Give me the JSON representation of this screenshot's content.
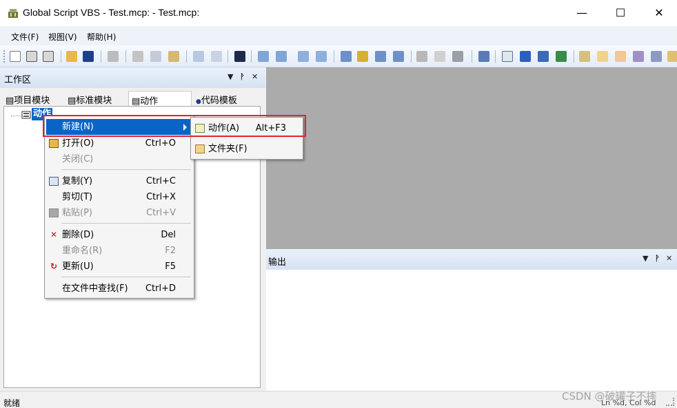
{
  "window": {
    "title": "Global Script VBS - Test.mcp: - Test.mcp:",
    "minimize": "—",
    "maximize": "☐",
    "close": "✕"
  },
  "menubar": {
    "items": [
      "文件(F)",
      "视图(V)",
      "帮助(H)"
    ]
  },
  "workspace": {
    "title": "工作区",
    "controls": {
      "dropdown": "▼",
      "pin": "ᚹ",
      "close": "✕"
    },
    "tabs": [
      {
        "icon": "script-module-icon",
        "label": "项目模块"
      },
      {
        "icon": "script-module-icon",
        "label": "标准模块"
      },
      {
        "icon": "script-module-icon",
        "label": "动作"
      },
      {
        "icon": "template-dot-icon",
        "label": "代码模板"
      }
    ],
    "tree": {
      "root_label": "动作"
    }
  },
  "context_menu": {
    "items": [
      {
        "icon": "",
        "label": "新建(N)",
        "shortcut": "",
        "has_submenu": true,
        "highlighted": true,
        "disabled": false
      },
      {
        "icon": "open-folder-icon",
        "label": "打开(O)",
        "shortcut": "Ctrl+O",
        "disabled": false
      },
      {
        "icon": "",
        "label": "关闭(C)",
        "shortcut": "",
        "disabled": true
      },
      {
        "icon": "copy-icon",
        "label": "复制(Y)",
        "shortcut": "Ctrl+C",
        "disabled": false
      },
      {
        "icon": "",
        "label": "剪切(T)",
        "shortcut": "Ctrl+X",
        "disabled": false
      },
      {
        "icon": "paste-icon",
        "label": "粘贴(P)",
        "shortcut": "Ctrl+V",
        "disabled": true
      },
      {
        "icon": "delete-icon",
        "label": "删除(D)",
        "shortcut": "Del",
        "disabled": false
      },
      {
        "icon": "",
        "label": "重命名(R)",
        "shortcut": "F2",
        "disabled": true
      },
      {
        "icon": "refresh-icon",
        "label": "更新(U)",
        "shortcut": "F5",
        "disabled": false
      },
      {
        "icon": "",
        "label": "在文件中查找(F)",
        "shortcut": "Ctrl+D",
        "disabled": false
      }
    ]
  },
  "submenu": {
    "items": [
      {
        "icon": "action-file-icon",
        "label": "动作(A)",
        "shortcut": "Alt+F3"
      },
      {
        "icon": "folder-icon",
        "label": "文件夹(F)",
        "shortcut": ""
      }
    ]
  },
  "output": {
    "title": "输出",
    "controls": {
      "dropdown": "▼",
      "pin": "ᚹ",
      "close": "✕"
    }
  },
  "statusbar": {
    "left": "就绪",
    "right": "Ln %d, Col %d"
  },
  "watermark": "CSDN @破罐子不摔",
  "colors": {
    "highlight": "#0a64c8",
    "annotation_box": "#e0242b",
    "editor_bg": "#ababab"
  }
}
